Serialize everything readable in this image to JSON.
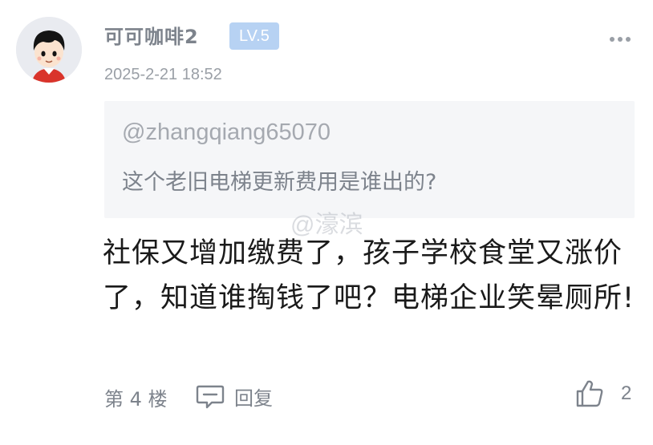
{
  "comment": {
    "username": "可可咖啡2",
    "level": "LV.5",
    "timestamp": "2025-2-21 18:52",
    "quote": {
      "author": "@zhangqiang65070",
      "text": "这个老旧电梯更新费用是谁出的?"
    },
    "body": "社保又增加缴费了，孩子学校食堂又涨价了，知道谁掏钱了吧？电梯企业笑晕厕所!",
    "floor": "第 4 楼",
    "reply_label": "回复",
    "like_count": "2"
  },
  "watermark": "@濠滨",
  "icons": {
    "avatar": "cartoon-child-avatar",
    "more": "more-dots-icon",
    "reply": "comment-bubble-icon",
    "like": "thumbs-up-icon"
  },
  "colors": {
    "badge_bg": "#b7d2f3",
    "muted_text": "#7d838c",
    "quote_bg": "#f5f6f8"
  }
}
